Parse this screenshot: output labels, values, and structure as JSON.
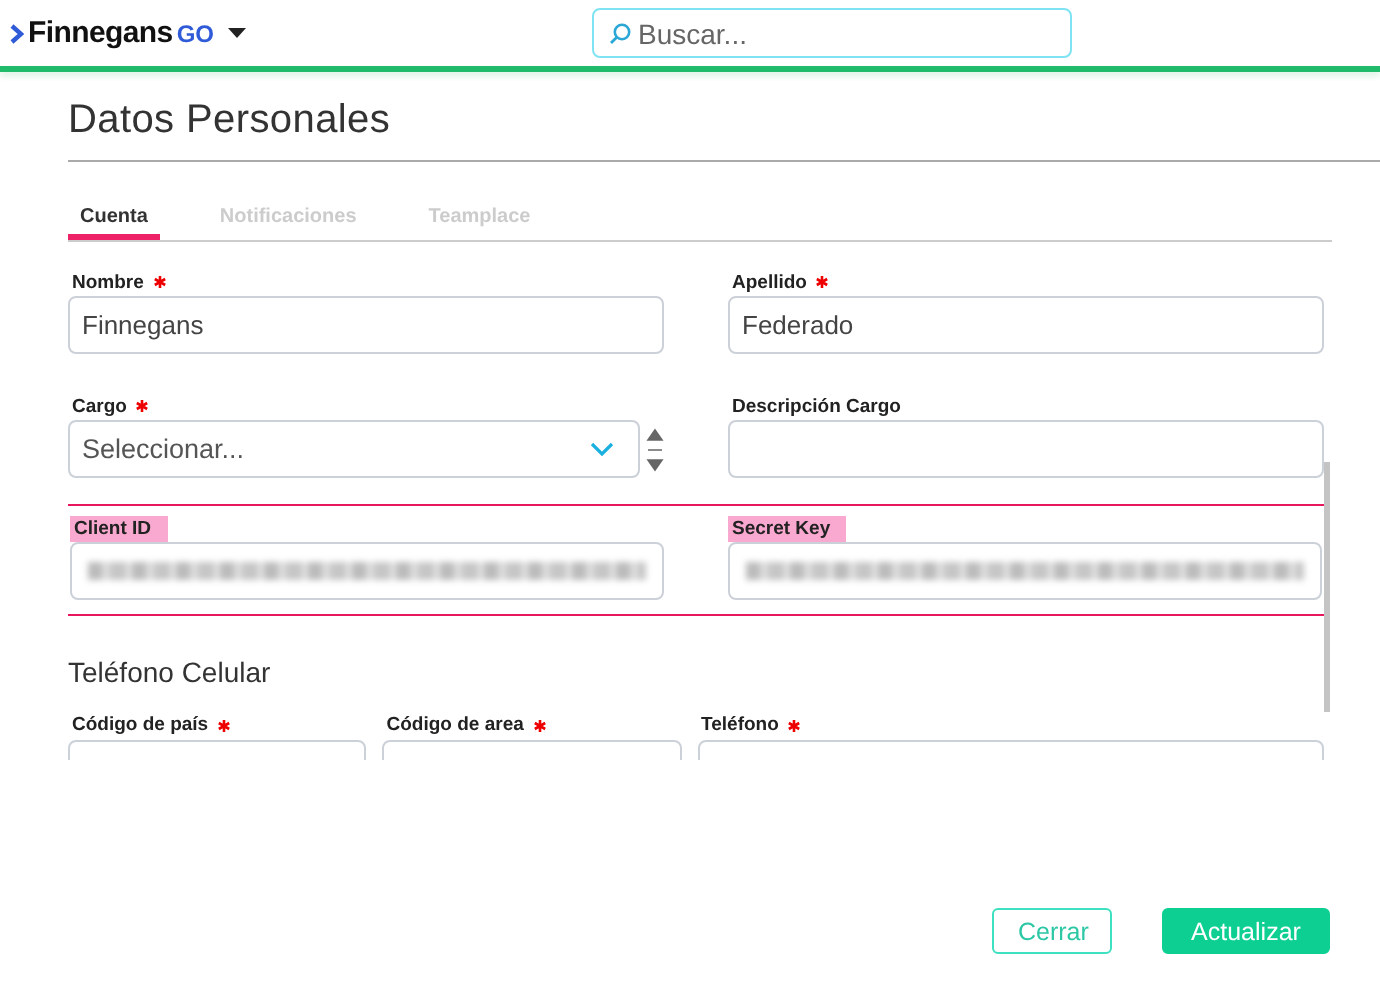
{
  "header": {
    "logo": {
      "brand": "Finnegans",
      "suffix": "GO"
    },
    "search": {
      "placeholder": "Buscar..."
    }
  },
  "page": {
    "title": "Datos Personales"
  },
  "tabs": [
    {
      "label": "Cuenta",
      "selected": true
    },
    {
      "label": "Notificaciones",
      "selected": false
    },
    {
      "label": "Teamplace",
      "selected": false
    }
  ],
  "form": {
    "rows": [
      {
        "highlighted": false,
        "fields": [
          {
            "kind": "text",
            "label": "Nombre",
            "required": true,
            "value": "Finnegans"
          },
          {
            "kind": "text",
            "label": "Apellido",
            "required": true,
            "value": "Federado"
          }
        ]
      },
      {
        "highlighted": false,
        "fields": [
          {
            "kind": "select",
            "label": "Cargo",
            "required": true,
            "placeholder": "Seleccionar..."
          },
          {
            "kind": "text",
            "label": "Descripción Cargo",
            "required": false
          }
        ]
      },
      {
        "highlighted": true,
        "fields": [
          {
            "kind": "redacted",
            "label": "Client ID",
            "required": false
          },
          {
            "kind": "redacted",
            "label": "Secret Key",
            "required": false
          }
        ]
      }
    ],
    "section": {
      "title": "Teléfono Celular",
      "fields": [
        {
          "kind": "text",
          "label": "Código de país",
          "required": true
        },
        {
          "kind": "text",
          "label": "Código de area",
          "required": true
        },
        {
          "kind": "text",
          "label": "Teléfono",
          "required": true
        }
      ]
    }
  },
  "buttons": [
    {
      "kind": "secondary",
      "label": "Cerrar"
    },
    {
      "kind": "primary",
      "label": "Actualizar"
    }
  ]
}
